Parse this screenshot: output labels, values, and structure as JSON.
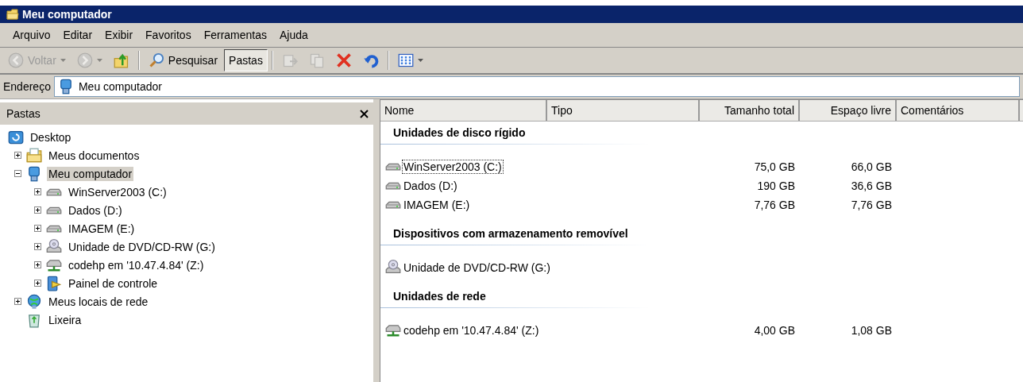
{
  "window": {
    "title": "Meu computador"
  },
  "menu": [
    "Arquivo",
    "Editar",
    "Exibir",
    "Favoritos",
    "Ferramentas",
    "Ajuda"
  ],
  "toolbar": [
    {
      "kind": "back",
      "label": "Voltar",
      "disabled": true,
      "dropdown": true
    },
    {
      "kind": "forward",
      "disabled": true,
      "dropdown": true
    },
    {
      "kind": "up",
      "disabled": false
    },
    {
      "kind": "separator"
    },
    {
      "kind": "search",
      "label": "Pesquisar",
      "disabled": false,
      "selected": false
    },
    {
      "kind": "folders",
      "label": "Pastas",
      "disabled": false,
      "selected": true
    },
    {
      "kind": "separator"
    },
    {
      "kind": "move",
      "disabled": true
    },
    {
      "kind": "copy",
      "disabled": true
    },
    {
      "kind": "delete",
      "disabled": false
    },
    {
      "kind": "undo",
      "disabled": false
    },
    {
      "kind": "separator"
    },
    {
      "kind": "views",
      "disabled": false,
      "dropdown": true
    }
  ],
  "address": {
    "label": "Endereço",
    "value": "Meu computador"
  },
  "folders_pane": {
    "title": "Pastas",
    "tree": [
      {
        "label": "Desktop",
        "kind": "desktop",
        "selected": false,
        "children": [
          {
            "label": "Meus documentos",
            "kind": "documents",
            "expanded": false,
            "selected": false
          },
          {
            "label": "Meu computador",
            "kind": "computer",
            "expanded": true,
            "selected": true,
            "children": [
              {
                "label": "WinServer2003 (C:)",
                "kind": "drive",
                "expanded": false,
                "selected": false
              },
              {
                "label": "Dados (D:)",
                "kind": "drive",
                "expanded": false,
                "selected": false
              },
              {
                "label": "IMAGEM (E:)",
                "kind": "drive",
                "expanded": false,
                "selected": false
              },
              {
                "label": "Unidade de DVD/CD-RW (G:)",
                "kind": "dvd",
                "expanded": false,
                "selected": false
              },
              {
                "label": "codehp em '10.47.4.84' (Z:)",
                "kind": "netdrive",
                "expanded": false,
                "selected": false
              },
              {
                "label": "Painel de controle",
                "kind": "control",
                "expanded": false,
                "selected": false
              }
            ]
          },
          {
            "label": "Meus locais de rede",
            "kind": "network",
            "expanded": false,
            "selected": false
          },
          {
            "label": "Lixeira",
            "kind": "recycle",
            "selected": false
          }
        ]
      }
    ]
  },
  "list": {
    "columns": [
      "Nome",
      "Tipo",
      "Tamanho total",
      "Espaço livre",
      "Comentários"
    ],
    "groups": [
      {
        "title": "Unidades de disco rígido",
        "items": [
          {
            "kind": "drive",
            "name": "WinServer2003 (C:)",
            "total": "75,0 GB",
            "free": "66,0 GB",
            "focused": true
          },
          {
            "kind": "drive",
            "name": "Dados (D:)",
            "total": "190 GB",
            "free": "36,6 GB",
            "focused": false
          },
          {
            "kind": "drive",
            "name": "IMAGEM (E:)",
            "total": "7,76 GB",
            "free": "7,76 GB",
            "focused": false
          }
        ]
      },
      {
        "title": "Dispositivos com armazenamento removível",
        "items": [
          {
            "kind": "dvd",
            "name": "Unidade de DVD/CD-RW (G:)",
            "focused": false
          }
        ]
      },
      {
        "title": "Unidades de rede",
        "items": [
          {
            "kind": "netdrive",
            "name": "codehp em '10.47.4.84' (Z:)",
            "total": "4,00 GB",
            "free": "1,08 GB",
            "focused": false
          }
        ]
      }
    ]
  }
}
